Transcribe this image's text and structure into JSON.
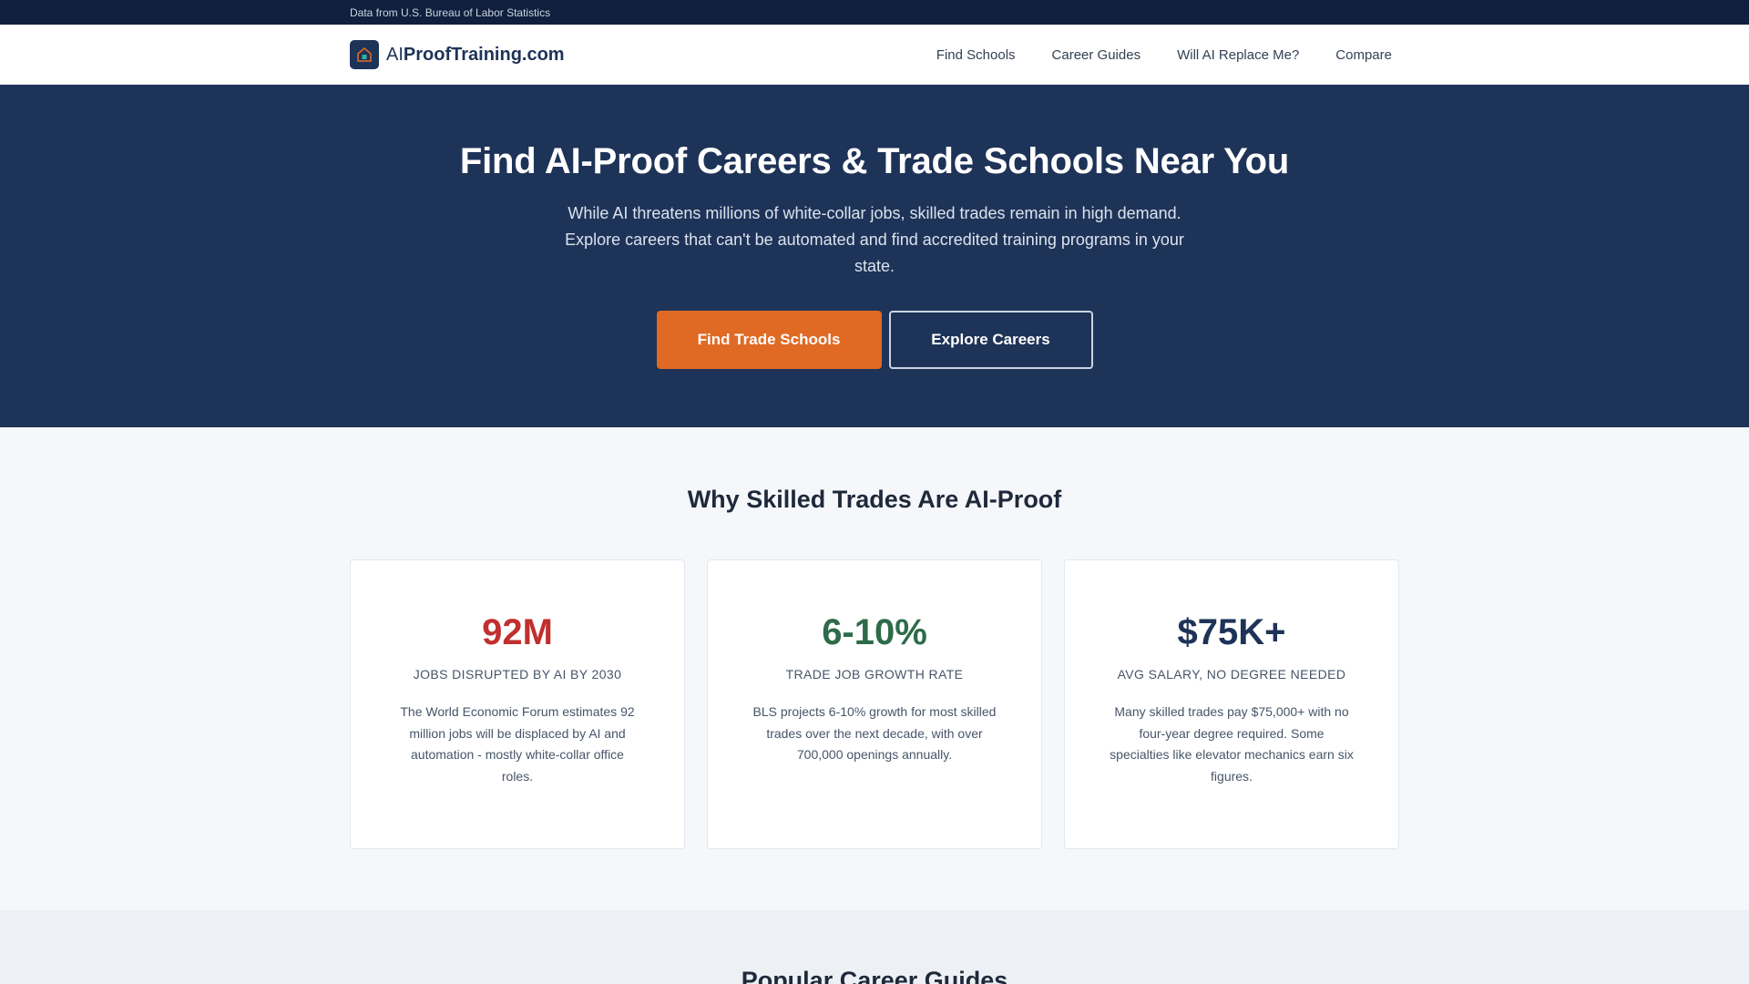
{
  "topbar": {
    "text": "Data from U.S. Bureau of Labor Statistics"
  },
  "header": {
    "logo_prefix": "AI",
    "logo_main": "ProofTraining.com",
    "nav": [
      {
        "label": "Find Schools"
      },
      {
        "label": "Career Guides"
      },
      {
        "label": "Will AI Replace Me?"
      },
      {
        "label": "Compare"
      }
    ]
  },
  "hero": {
    "title": "Find AI-Proof Careers & Trade Schools Near You",
    "subtitle": "While AI threatens millions of white-collar jobs, skilled trades remain in high demand. Explore careers that can't be automated and find accredited training programs in your state.",
    "primary_button": "Find Trade Schools",
    "secondary_button": "Explore Careers"
  },
  "why": {
    "title": "Why Skilled Trades Are AI-Proof",
    "cards": [
      {
        "value": "92M",
        "color": "#c0302f",
        "label": "JOBS DISRUPTED BY AI BY 2030",
        "description": "The World Economic Forum estimates 92 million jobs will be displaced by AI and automation - mostly white-collar office roles."
      },
      {
        "value": "6-10%",
        "color": "#2d6b4a",
        "label": "TRADE JOB GROWTH RATE",
        "description": "BLS projects 6-10% growth for most skilled trades over the next decade, with over 700,000 openings annually."
      },
      {
        "value": "$75K+",
        "color": "#1e3358",
        "label": "AVG SALARY, NO DEGREE NEEDED",
        "description": "Many skilled trades pay $75,000+ with no four-year degree required. Some specialties like elevator mechanics earn six figures."
      }
    ]
  },
  "popular": {
    "title": "Popular Career Guides"
  },
  "colors": {
    "navy": "#1e3358",
    "accent_orange": "#e06a24",
    "topbar": "#0f1f3d"
  }
}
